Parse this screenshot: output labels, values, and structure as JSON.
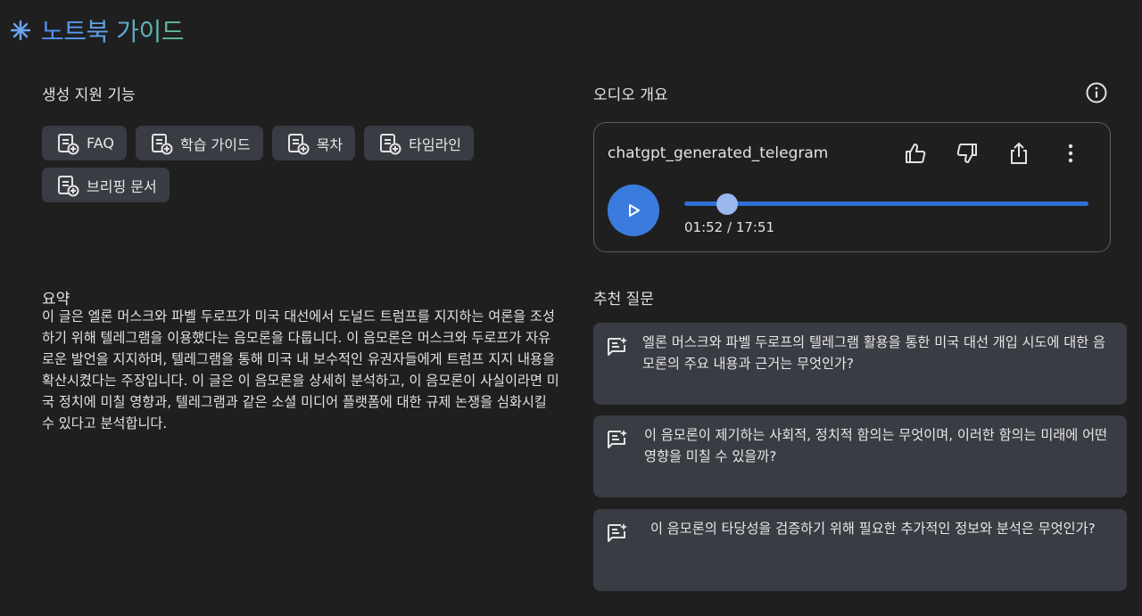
{
  "header": {
    "title": "노트북 가이드",
    "icon": "spark-icon"
  },
  "generate": {
    "heading": "생성 지원 기능",
    "chips": [
      {
        "label": "FAQ",
        "icon": "note-add-icon"
      },
      {
        "label": "학습 가이드",
        "icon": "note-add-icon"
      },
      {
        "label": "목차",
        "icon": "note-add-icon"
      },
      {
        "label": "타임라인",
        "icon": "note-add-icon"
      },
      {
        "label": "브리핑 문서",
        "icon": "note-add-icon"
      }
    ]
  },
  "summary": {
    "heading": "요약",
    "text": "이 글은 엘론 머스크와 파벨 두로프가 미국 대선에서 도널드 트럼프를 지지하는 여론을 조성하기 위해 텔레그램을 이용했다는 음모론을 다룹니다. 이 음모론은 머스크와 두로프가 자유로운 발언을 지지하며, 텔레그램을 통해 미국 내 보수적인 유권자들에게 트럼프 지지 내용을 확산시켰다는 주장입니다. 이 글은 이 음모론을 상세히 분석하고, 이 음모론이 사실이라면 미국 정치에 미칠 영향과, 텔레그램과 같은 소셜 미디어 플랫폼에 대한 규제 논쟁을 심화시킬 수 있다고 분석합니다."
  },
  "audio": {
    "heading": "오디오 개요",
    "file_name": "chatgpt_generated_telegram",
    "time_display": "01:52 / 17:51",
    "progress": 0.105,
    "accent": "#3b7bdd"
  },
  "suggested": {
    "heading": "추천 질문",
    "questions": [
      "엘론 머스크와 파벨 두로프의 텔레그램 활용을 통한 미국 대선 개입 시도에 대한 음모론의 주요 내용과 근거는 무엇인가?",
      "이 음모론이 제기하는 사회적, 정치적 함의는 무엇이며, 이러한 함의는 미래에 어떤 영향을 미칠 수 있을까?",
      "이 음모론의 타당성을 검증하기 위해 필요한 추가적인 정보와 분석은 무엇인가?"
    ]
  }
}
